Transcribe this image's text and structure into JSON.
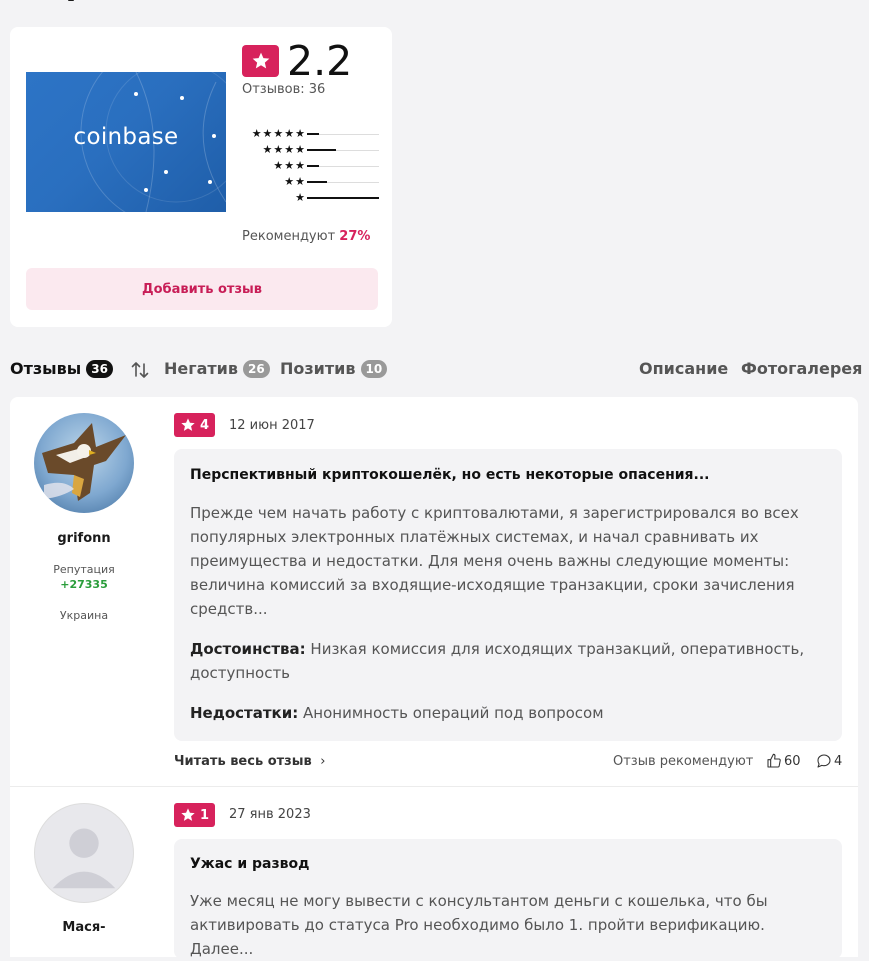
{
  "product": {
    "logo_text": "coinbase",
    "rating": "2.2",
    "reviews_count_label": "Отзывов: 36",
    "star_distribution": [
      {
        "stars": "★★★★★",
        "fraction": 0.17
      },
      {
        "stars": "★★★★",
        "fraction": 0.4
      },
      {
        "stars": "★★★",
        "fraction": 0.17
      },
      {
        "stars": "★★",
        "fraction": 0.28
      },
      {
        "stars": "★",
        "fraction": 1.0
      }
    ],
    "recommend_label": "Рекомендуют",
    "recommend_value": "27%",
    "add_review_label": "Добавить отзыв",
    "accent_color": "#d7225c"
  },
  "tabs": {
    "reviews": {
      "label": "Отзывы",
      "count": "36"
    },
    "negative": {
      "label": "Негатив",
      "count": "26"
    },
    "positive": {
      "label": "Позитив",
      "count": "10"
    },
    "description": "Описание",
    "gallery": "Фотогалерея"
  },
  "reviews": [
    {
      "rating": "4",
      "date": "12 июн 2017",
      "user": "grifonn",
      "reputation_label": "Репутация",
      "reputation_value": "+27335",
      "country": "Украина",
      "title": "Перспективный криптокошелёк, но есть некоторые опасения...",
      "text_lines": [
        "Прежде чем начать работу с криптовалютами, я зарегистрировался во всех",
        "популярных электронных платёжных системах, и начал сравнивать их",
        "преимущества и недостатки. Для меня очень важны следующие моменты:",
        "величина комиссий за входящие-исходящие транзакции, сроки зачисления",
        "средств..."
      ],
      "pros_label": "Достоинства:",
      "pros_lines": [
        "Низкая комиссия для исходящих транзакций, оперативность,",
        "доступность"
      ],
      "cons_label": "Недостатки:",
      "cons_text": "Анонимность операций под вопросом",
      "read_more": "Читать весь отзыв",
      "recommend_label": "Отзыв рекомендуют",
      "likes": "60",
      "comments": "4"
    },
    {
      "rating": "1",
      "date": "27 янв 2023",
      "user": "Мася-",
      "title": "Ужас и развод",
      "text_lines": [
        "Уже месяц не могу вывести с консультантом деньги с кошелька, что бы",
        "активировать до статуса Pro необходимо было 1. пройти верификацию. Далее..."
      ]
    }
  ]
}
